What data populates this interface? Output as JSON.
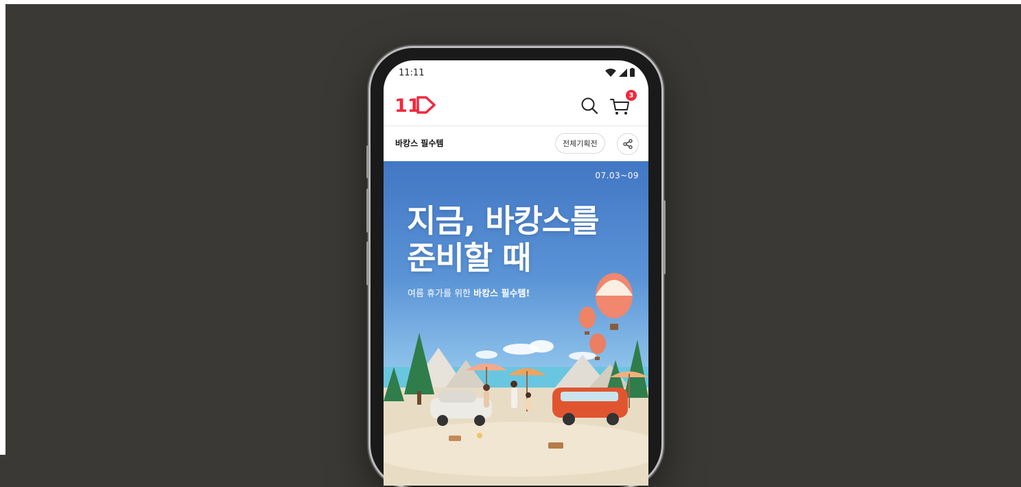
{
  "status_bar": {
    "time": "11:11"
  },
  "app_bar": {
    "logo": "11",
    "cart_count": "3"
  },
  "sub_bar": {
    "title": "바캉스 필수템",
    "all_events_button": "전체기획전"
  },
  "banner": {
    "date_range": "07.03~09",
    "headline_line1": "지금, 바캉스를",
    "headline_line2": "준비할 때",
    "subtitle_prefix": "여름 휴가를 위한 ",
    "subtitle_bold": "바캉스 필수템!"
  },
  "colors": {
    "brand": "#f1283c",
    "background": "#3a3935",
    "sky": "#4277c4"
  }
}
